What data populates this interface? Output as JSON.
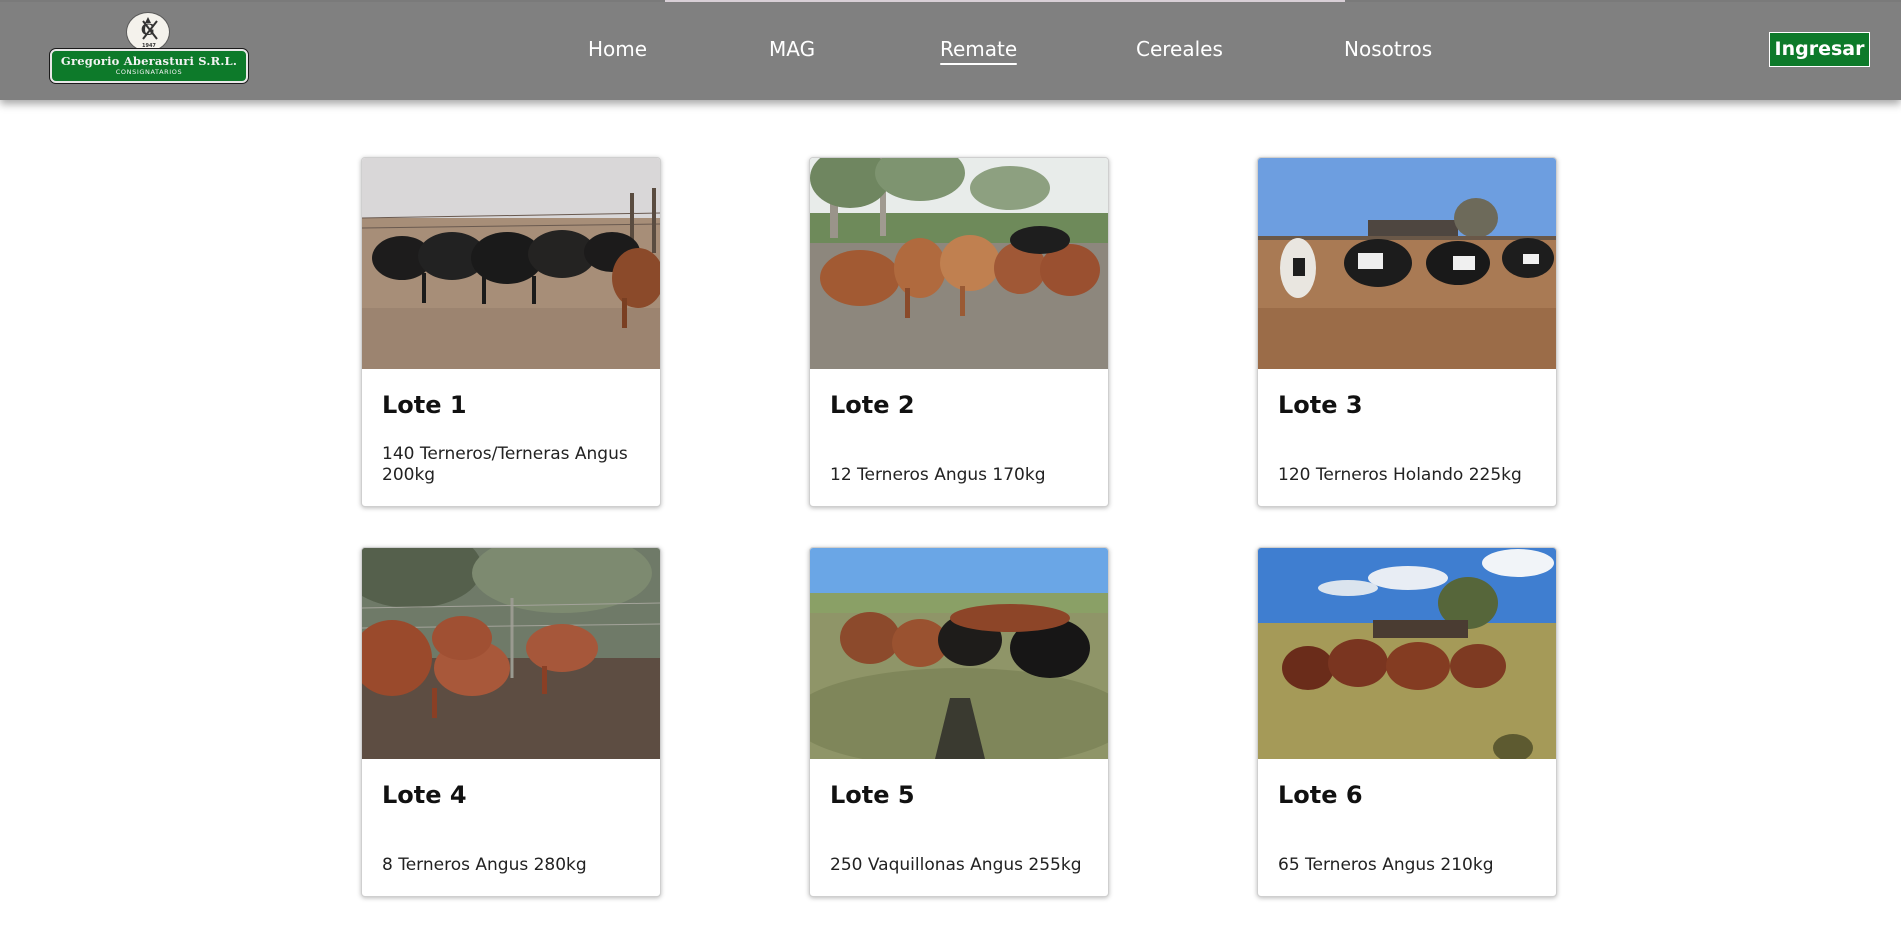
{
  "brand": {
    "name": "Gregorio Aberasturi S.R.L.",
    "subtitle": "CONSIGNATARIOS",
    "emblem_year": "1947",
    "emblem_monogram": "GA"
  },
  "nav": {
    "items": [
      {
        "label": "Home",
        "active": false
      },
      {
        "label": "MAG",
        "active": false
      },
      {
        "label": "Remate",
        "active": true
      },
      {
        "label": "Cereales",
        "active": false
      },
      {
        "label": "Nosotros",
        "active": false
      }
    ],
    "login_label": "Ingresar"
  },
  "colors": {
    "header_bg": "#808080",
    "brand_green": "#0d7a2a",
    "nav_text": "#ffffff"
  },
  "lots": [
    {
      "title": "Lote 1",
      "description": "140 Terneros/Terneras Angus 200kg",
      "photo": "black angus calves in corral"
    },
    {
      "title": "Lote 2",
      "description": "12 Terneros Angus 170kg",
      "photo": "red angus calves near eucalyptus trees"
    },
    {
      "title": "Lote 3",
      "description": "120 Terneros Holando 225kg",
      "photo": "black and white holstein calves in pen"
    },
    {
      "title": "Lote 4",
      "description": "8 Terneros Angus 280kg",
      "photo": "red angus calves walking by fence"
    },
    {
      "title": "Lote 5",
      "description": "250 Vaquillonas Angus 255kg",
      "photo": "red and black heifers on grass"
    },
    {
      "title": "Lote 6",
      "description": "65 Terneros Angus 210kg",
      "photo": "red angus calves in open field"
    }
  ]
}
